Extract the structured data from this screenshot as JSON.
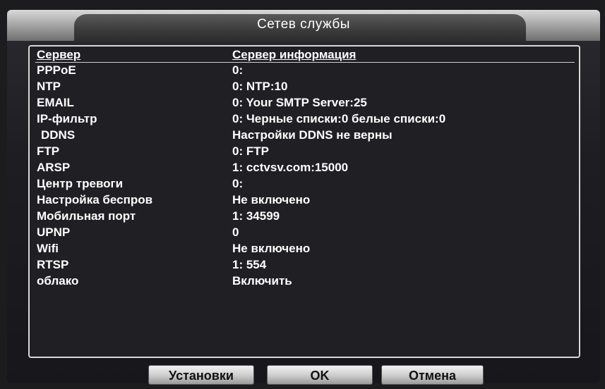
{
  "window": {
    "title": "Сетев службы"
  },
  "table": {
    "header_server": "Сервер",
    "header_info": "Сервер информация",
    "rows": [
      {
        "server": "PPPoE",
        "info": "0:"
      },
      {
        "server": "NTP",
        "info": "0: NTP:10"
      },
      {
        "server": "EMAIL",
        "info": "0: Your SMTP Server:25"
      },
      {
        "server": "IP-фильтр",
        "info": "0: Черные списки:0 белые списки:0"
      },
      {
        "server": " DDNS",
        "info": "Настройки DDNS не верны"
      },
      {
        "server": "FTP",
        "info": "0: FTP"
      },
      {
        "server": "ARSP",
        "info": "1: cctvsv.com:15000"
      },
      {
        "server": "Центр тревоги",
        "info": "0:"
      },
      {
        "server": "Настройка беспров",
        "info": "Не включено"
      },
      {
        "server": "Мобильная порт",
        "info": "1: 34599"
      },
      {
        "server": "UPNP",
        "info": "0"
      },
      {
        "server": "Wifi",
        "info": "Не включено"
      },
      {
        "server": "RTSP",
        "info": "1: 554"
      },
      {
        "server": "облако",
        "info": "Включить"
      }
    ]
  },
  "buttons": {
    "settings": "Установки",
    "ok": "OK",
    "cancel": "Отмена"
  }
}
